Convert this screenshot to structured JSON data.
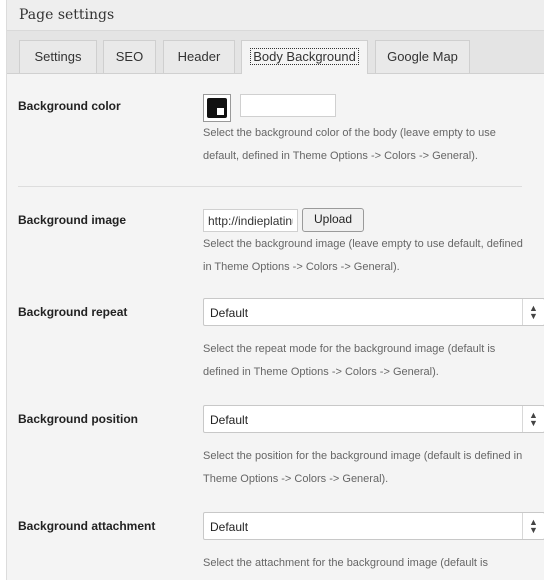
{
  "panel": {
    "title": "Page settings"
  },
  "tabs": [
    {
      "label": "Settings",
      "active": false
    },
    {
      "label": "SEO",
      "active": false
    },
    {
      "label": "Header",
      "active": false
    },
    {
      "label": "Body Background",
      "active": true
    },
    {
      "label": "Google Map",
      "active": false
    }
  ],
  "fields": {
    "bg_color": {
      "label": "Background color",
      "value": "",
      "swatch_color": "#111111",
      "desc_line1": "Select the background color of the body (leave empty to use",
      "desc_line2": "default, defined in Theme Options -> Colors -> General)."
    },
    "bg_image": {
      "label": "Background image",
      "value": "http://indieplatinum.com/",
      "upload_label": "Upload",
      "desc_line1": "Select the background image (leave empty to use default, defined",
      "desc_line2": "in Theme Options -> Colors -> General)."
    },
    "bg_repeat": {
      "label": "Background repeat",
      "selected": "Default",
      "desc_line1": "Select the repeat mode for the background image (default is",
      "desc_line2": "defined in Theme Options -> Colors -> General)."
    },
    "bg_position": {
      "label": "Background position",
      "selected": "Default",
      "desc_line1": "Select the position for the background image (default is defined in",
      "desc_line2": "Theme Options -> Colors -> General)."
    },
    "bg_attachment": {
      "label": "Background attachment",
      "selected": "Default",
      "desc_line1": "Select the attachment for the background image (default is"
    }
  },
  "icons": {
    "select_arrow": "up-down-chevron-icon"
  }
}
